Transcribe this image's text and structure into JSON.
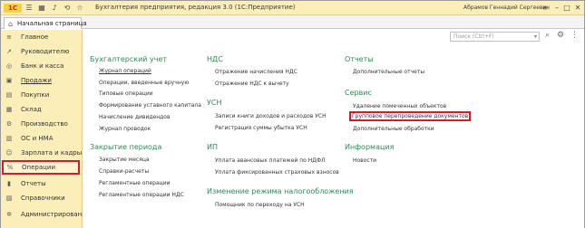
{
  "titlebar": {
    "logo": "1С",
    "title": "Бухгалтерия предприятия, редакция 3.0  (1С:Предприятие)",
    "user": "Абрамов Геннадий Сергеевич"
  },
  "tabbar": {
    "home_tab": "Начальная страница"
  },
  "sidebar": {
    "items": [
      {
        "label": "Главное",
        "icon": "menu-icon"
      },
      {
        "label": "Руководителю",
        "icon": "chart-icon"
      },
      {
        "label": "Банк и касса",
        "icon": "coins-icon"
      },
      {
        "label": "Продажи",
        "icon": "cart-icon"
      },
      {
        "label": "Покупки",
        "icon": "basket-icon"
      },
      {
        "label": "Склад",
        "icon": "warehouse-icon"
      },
      {
        "label": "Производство",
        "icon": "factory-icon"
      },
      {
        "label": "ОС и НМА",
        "icon": "building-icon"
      },
      {
        "label": "Зарплата и кадры",
        "icon": "people-icon"
      },
      {
        "label": "Операции",
        "icon": "operations-icon"
      },
      {
        "label": "Отчеты",
        "icon": "report-icon"
      },
      {
        "label": "Справочники",
        "icon": "book-icon"
      },
      {
        "label": "Администрирование",
        "icon": "gear-icon"
      }
    ]
  },
  "search": {
    "placeholder": "Поиск (Ctrl+F)"
  },
  "sections": {
    "accounting": {
      "title": "Бухгалтерский учет",
      "links": [
        "Журнал операций",
        "Операции, введенные вручную",
        "Типовые операции",
        "Формирование уставного капитала",
        "Начисление дивидендов",
        "Журнал проводок"
      ]
    },
    "closing": {
      "title": "Закрытие периода",
      "links": [
        "Закрытие месяца",
        "Справки-расчеты",
        "Регламентные операции",
        "Регламентные операции НДС"
      ]
    },
    "vat": {
      "title": "НДС",
      "links": [
        "Отражение начисления НДС",
        "Отражение НДС к вычету"
      ]
    },
    "usn": {
      "title": "УСН",
      "links": [
        "Записи книги доходов и расходов УСН",
        "Регистрация суммы убытка УСН"
      ]
    },
    "ip": {
      "title": "ИП",
      "links": [
        "Уплата авансовых платежей по НДФЛ",
        "Уплата фиксированных страховых взносов"
      ]
    },
    "regime": {
      "title": "Изменение режима налогообложения",
      "links": [
        "Помощник по переходу на УСН"
      ]
    },
    "reports": {
      "title": "Отчеты",
      "links": [
        "Дополнительные отчеты"
      ]
    },
    "service": {
      "title": "Сервис",
      "links": [
        "Удаление помеченных объектов",
        "Групповое перепроведение документов",
        "Дополнительные обработки"
      ]
    },
    "info": {
      "title": "Информация",
      "links": [
        "Новости"
      ]
    }
  },
  "highlight_color": "#d31b2c",
  "heading_color": "#2e8b57"
}
